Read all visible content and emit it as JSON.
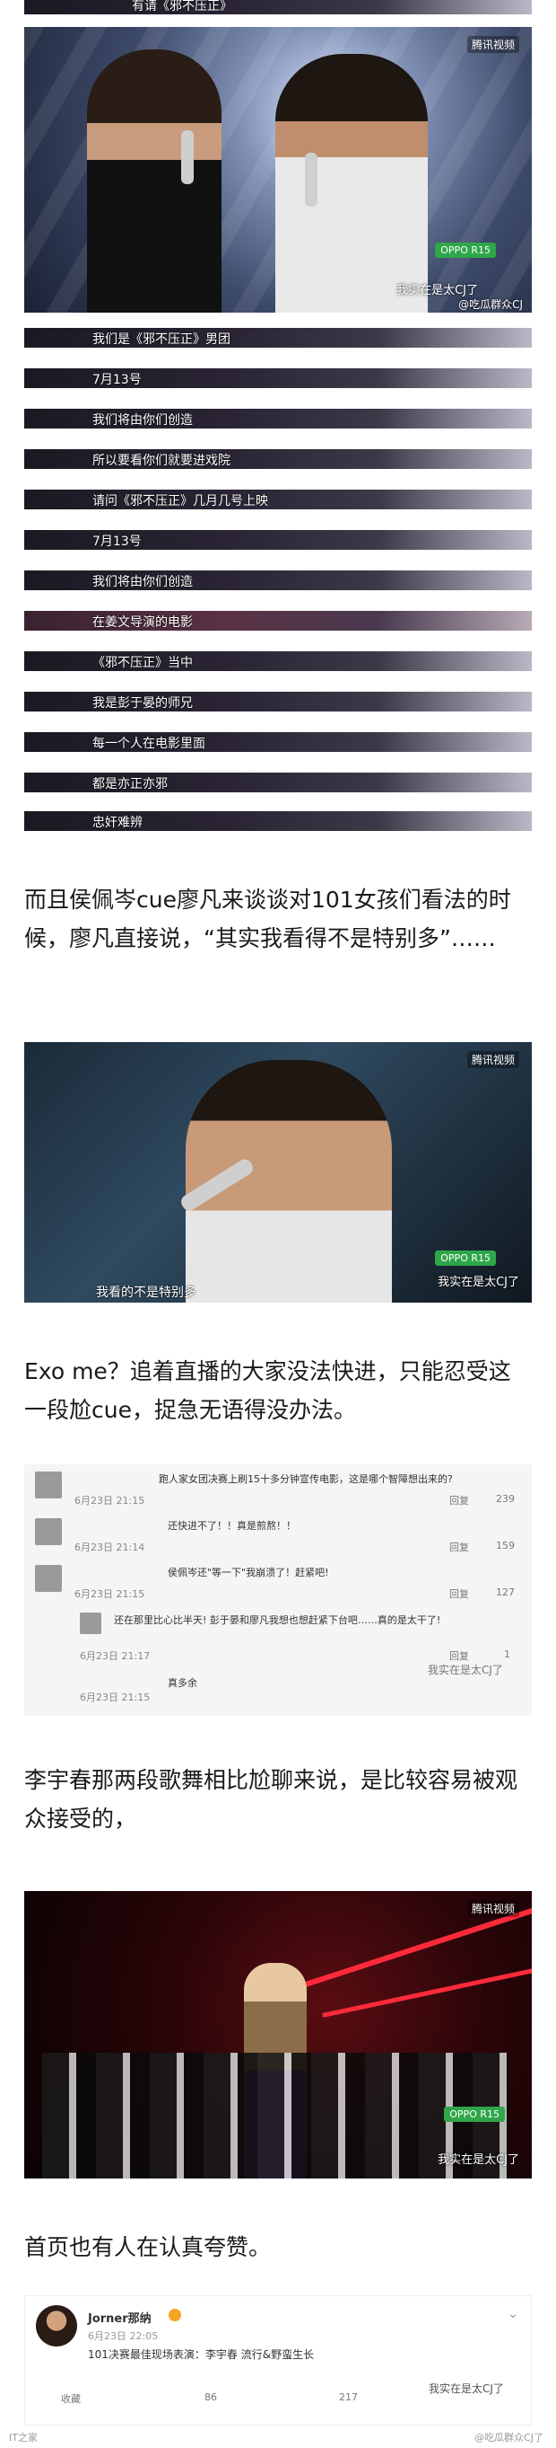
{
  "top_caption": "有请《邪不压正》",
  "video1": {
    "logo": "腾讯视频",
    "oppo": "OPPO R15",
    "watermark": "我实在是太CJ了",
    "watermark_sub": "@吃瓜群众CJ"
  },
  "subtitles": [
    "我们是《邪不压正》男团",
    "7月13号",
    "我们将由你们创造",
    "所以要看你们就要进戏院",
    "请问《邪不压正》几月几号上映",
    "7月13号",
    "我们将由你们创造",
    "在姜文导演的电影",
    "《邪不压正》当中",
    "我是彭于晏的师兄",
    "每一个人在电影里面",
    "都是亦正亦邪",
    "忠奸难辨"
  ],
  "para1": "而且侯佩岑cue廖凡来谈谈对101女孩们看法的时候，廖凡直接说，“其实我看得不是特别多”……",
  "video2": {
    "logo": "腾讯视频",
    "oppo": "OPPO R15",
    "watermark": "我实在是太CJ了",
    "subtitle": "我看的不是特别多"
  },
  "para2": "Exo me？追着直播的大家没法快进，只能忍受这一段尬cue，捉急无语得没办法。",
  "comments": [
    {
      "text": "跑人家女团决赛上刷15十多分钟宣传电影，这是哪个智障想出来的?",
      "time": "6月23日 21:15",
      "reply": "回复",
      "likes": "239"
    },
    {
      "text": "还快进不了！！真是煎熬！！",
      "time": "6月23日 21:14",
      "reply": "回复",
      "likes": "159"
    },
    {
      "text": "侯佩岑还\"等一下\"我崩溃了！赶紧吧!",
      "time": "6月23日 21:15",
      "reply": "回复",
      "likes": "127"
    },
    {
      "text": "还在那里比心比半天! 彭于晏和廖凡我想也想赶紧下台吧……真的是太干了!",
      "time": "6月23日 21:17",
      "reply": "回复",
      "likes": "1"
    },
    {
      "text": "真多余",
      "time": "6月23日 21:15",
      "reply": "",
      "likes": ""
    }
  ],
  "comment_watermark": "我实在是太CJ了",
  "para3": "李宇春那两段歌舞相比尬聊来说，是比较容易被观众接受的，",
  "video3": {
    "logo": "腾讯视频",
    "oppo": "OPPO R15",
    "watermark": "我实在是太CJ了"
  },
  "para4": "首页也有人在认真夸赞。",
  "weibo": {
    "user": "Jorner那纳",
    "time": "6月23日 22:05",
    "content": "101决赛最佳现场表演：李宇春 流行&野蛮生长",
    "actions": [
      "收藏",
      "86",
      "217",
      "我实在是太CJ了"
    ],
    "watermark": "@吃瓜群众CJ了"
  },
  "footer_left": "IT之家",
  "colors": {
    "accent": "#2fa64a",
    "text": "#1a1a1a"
  }
}
